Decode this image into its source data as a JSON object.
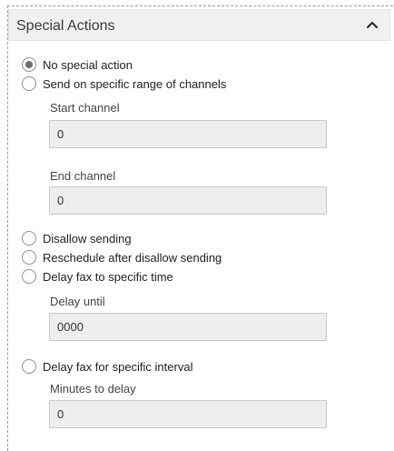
{
  "section": {
    "title": "Special Actions",
    "collapse_icon": "chevron-up-icon"
  },
  "options": {
    "no_special_action": {
      "label": "No special action",
      "selected": true
    },
    "channel_range": {
      "label": "Send on specific range of channels",
      "selected": false
    },
    "disallow_sending": {
      "label": "Disallow sending",
      "selected": false
    },
    "reschedule": {
      "label": "Reschedule after disallow sending",
      "selected": false
    },
    "delay_time": {
      "label": "Delay fax to specific time",
      "selected": false
    },
    "delay_interval": {
      "label": "Delay fax for specific interval",
      "selected": false
    }
  },
  "fields": {
    "start_channel": {
      "label": "Start channel",
      "value": "0"
    },
    "end_channel": {
      "label": "End channel",
      "value": "0"
    },
    "delay_until": {
      "label": "Delay until",
      "value": "0000"
    },
    "minutes_to_delay": {
      "label": "Minutes to delay",
      "value": "0"
    }
  }
}
